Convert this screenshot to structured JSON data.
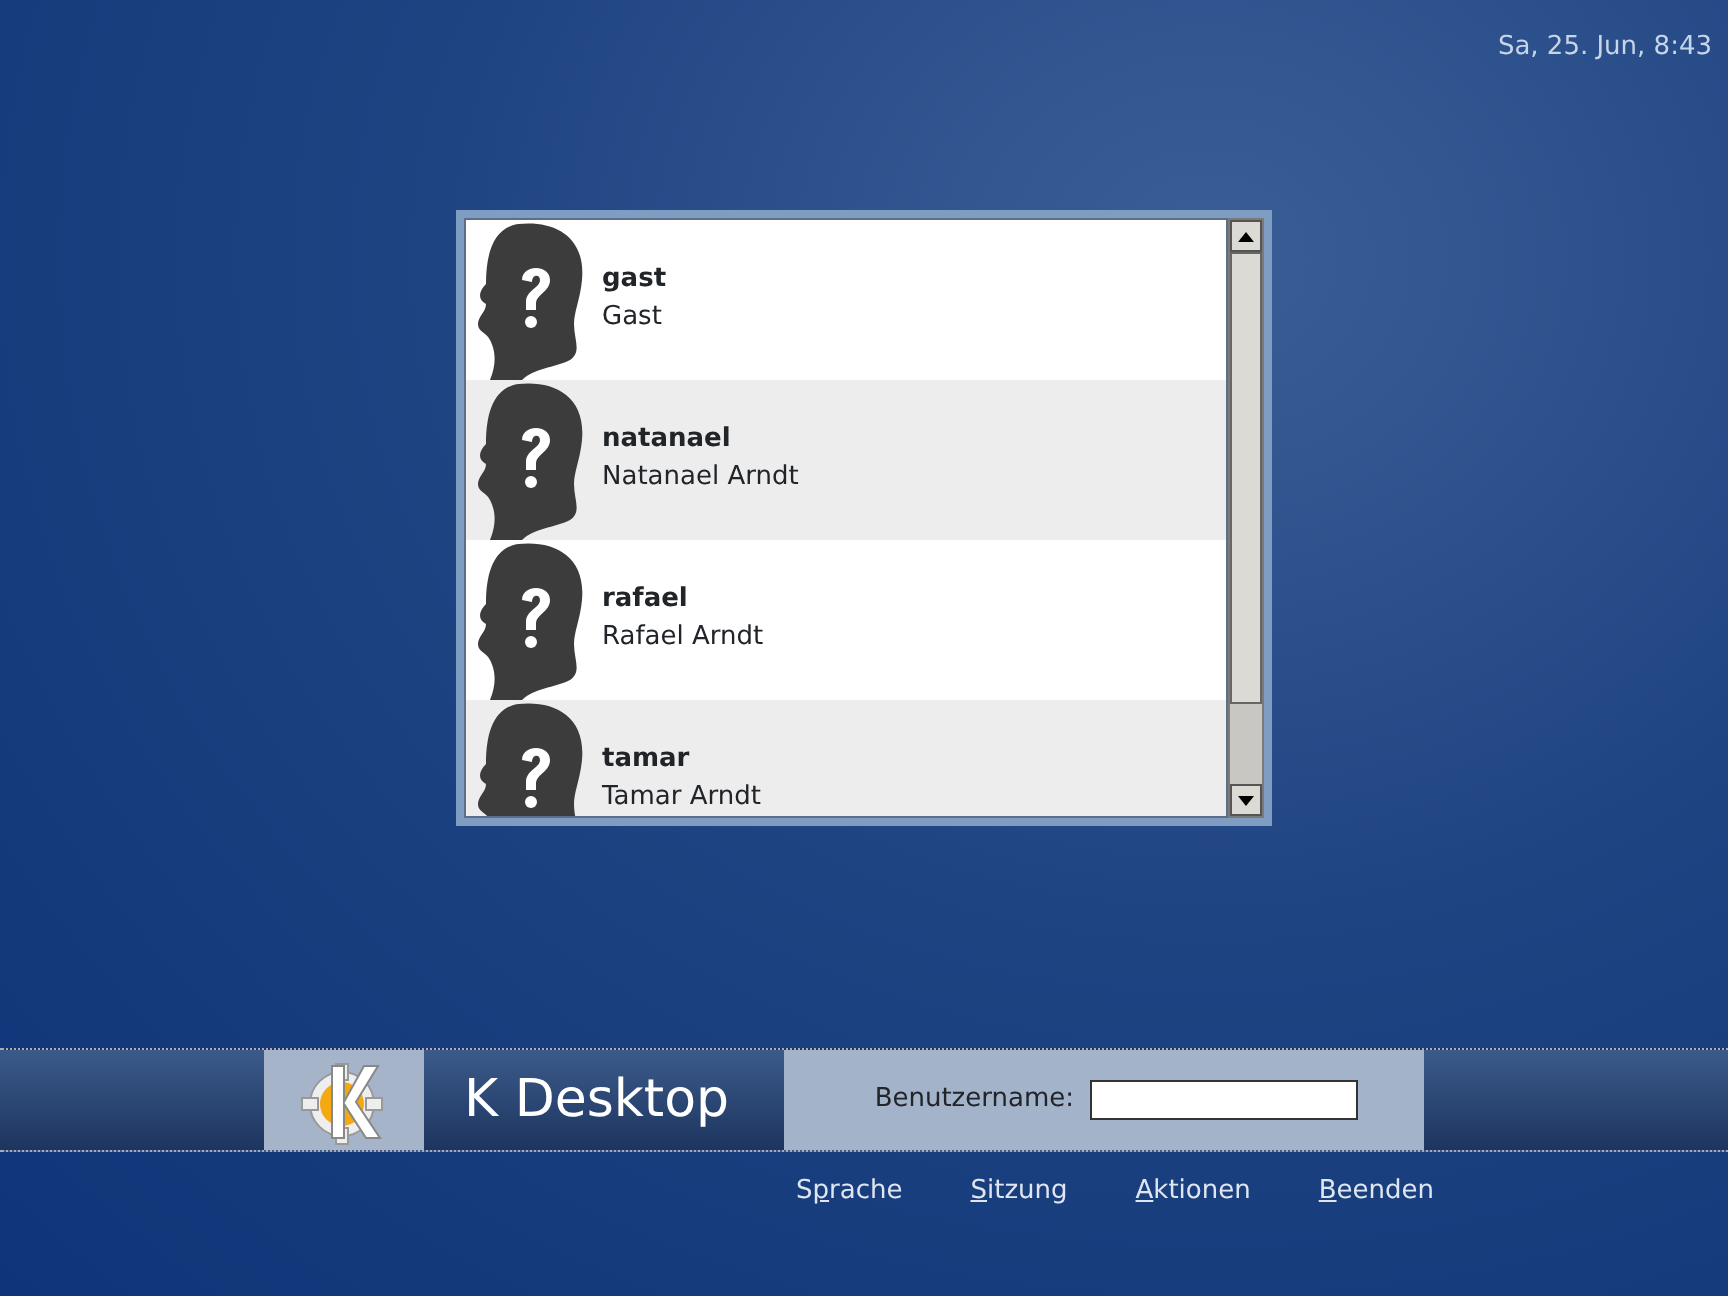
{
  "clock": "Sa, 25. Jun,  8:43",
  "users": [
    {
      "login": "gast",
      "full_name": "Gast",
      "selected": false
    },
    {
      "login": "natanael",
      "full_name": "Natanael Arndt",
      "selected": false
    },
    {
      "login": "rafael",
      "full_name": "Rafael Arndt",
      "selected": false
    },
    {
      "login": "tamar",
      "full_name": "Tamar Arndt",
      "selected": false
    }
  ],
  "banner": {
    "title": "K Desktop",
    "username_label": "Benutzername:"
  },
  "menu": [
    {
      "label": "Sprache",
      "kind": "mnemonic2"
    },
    {
      "label": "Sitzung",
      "kind": "mnemonic1"
    },
    {
      "label": "Aktionen",
      "kind": "mnemonic1"
    },
    {
      "label": "Beenden",
      "kind": "mnemonic1"
    }
  ]
}
